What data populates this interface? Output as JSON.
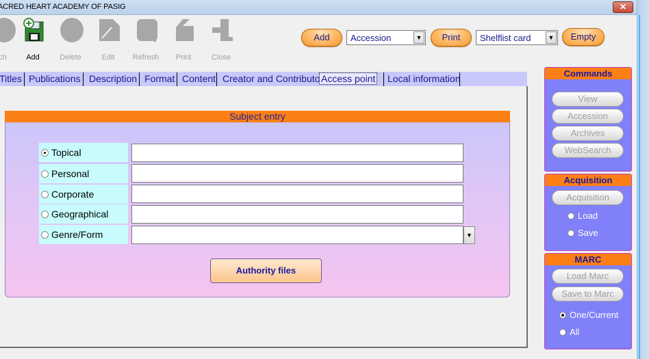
{
  "window": {
    "title": "ACRED HEART ACADEMY OF PASIG",
    "close_glyph": "✕"
  },
  "toolbar": {
    "buttons": [
      {
        "label": "ch",
        "icon": "search-icon",
        "active": false
      },
      {
        "label": "Add",
        "icon": "add-record-icon",
        "active": true
      },
      {
        "label": "Delete",
        "icon": "delete-icon",
        "active": false
      },
      {
        "label": "Edit",
        "icon": "edit-icon",
        "active": false
      },
      {
        "label": "Refresh",
        "icon": "refresh-icon",
        "active": false
      },
      {
        "label": "Print",
        "icon": "print-icon",
        "active": false
      },
      {
        "label": "Close",
        "icon": "close-icon",
        "active": false
      }
    ]
  },
  "top_controls": {
    "add_label": "Add",
    "add_select_value": "Accession",
    "print_label": "Print",
    "print_select_value": "Shelflist card",
    "empty_label": "Empty"
  },
  "tabs": [
    "Titles",
    "Publications",
    "Description",
    "Format",
    "Content",
    "Creator and Contributor",
    "Access point",
    "Local information"
  ],
  "active_tab": "Access point",
  "subject_entry": {
    "header": "Subject entry",
    "rows": [
      {
        "label": "Topical",
        "selected": true,
        "value": ""
      },
      {
        "label": "Personal",
        "selected": false,
        "value": ""
      },
      {
        "label": "Corporate",
        "selected": false,
        "value": ""
      },
      {
        "label": "Geographical",
        "selected": false,
        "value": ""
      },
      {
        "label": "Genre/Form",
        "selected": false,
        "value": ""
      }
    ],
    "authority_button": "Authority files"
  },
  "commands": {
    "header": "Commands",
    "buttons": [
      "View",
      "Accession",
      "Archives",
      "WebSearch"
    ]
  },
  "acquisition": {
    "header": "Acquisition",
    "button": "Acquisition",
    "options": [
      "Load",
      "Save"
    ]
  },
  "marc": {
    "header": "MARC",
    "buttons": [
      "Load Marc",
      "Save to Marc"
    ],
    "options": [
      {
        "label": "One/Current",
        "selected": true
      },
      {
        "label": "All",
        "selected": false
      }
    ]
  },
  "colors": {
    "accent_orange": "#fb7f14",
    "panel_purple": "#8080f8",
    "label_cyan": "#c8fcfc"
  }
}
